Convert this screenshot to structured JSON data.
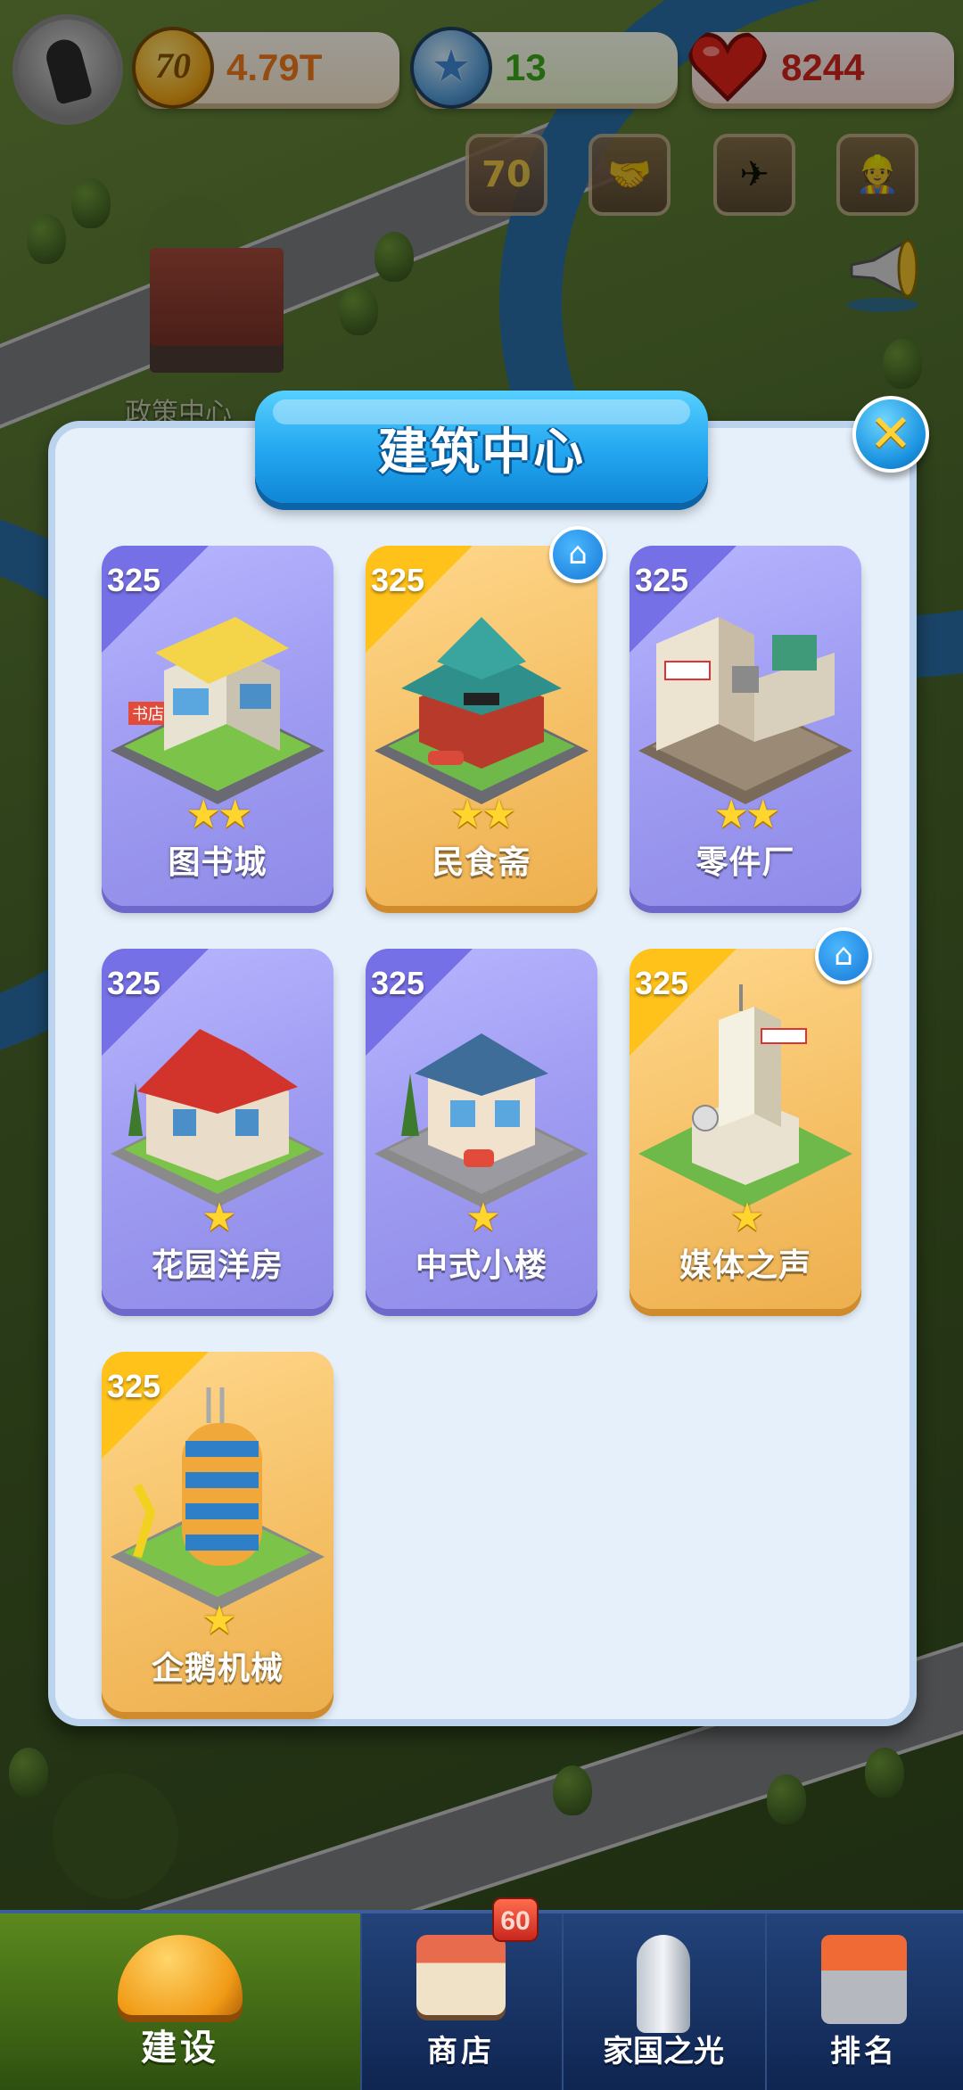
{
  "top_bar": {
    "coins": "4.79T",
    "coin_icon_text": "70",
    "stars": "13",
    "hearts": "8244",
    "colors": {
      "coins": "#f27a1a",
      "stars": "#3aa81a",
      "hearts": "#d2261e"
    }
  },
  "feature_icons": [
    {
      "icon": "anniversary-70-icon",
      "glyph": "70"
    },
    {
      "icon": "handshake-icon",
      "glyph": "🤝"
    },
    {
      "icon": "campaign-icon",
      "glyph": "✈"
    },
    {
      "icon": "worker-icon",
      "glyph": "👷"
    }
  ],
  "map": {
    "label": "政策中心"
  },
  "dialog": {
    "title": "建筑中心",
    "cards": [
      {
        "price": "325",
        "stars": "★★",
        "name": "图书城",
        "theme": "purple",
        "home_badge": false
      },
      {
        "price": "325",
        "stars": "★★",
        "name": "民食斋",
        "theme": "gold",
        "home_badge": true
      },
      {
        "price": "325",
        "stars": "★★",
        "name": "零件厂",
        "theme": "purple",
        "home_badge": false
      },
      {
        "price": "325",
        "stars": "★",
        "name": "花园洋房",
        "theme": "purple",
        "home_badge": false
      },
      {
        "price": "325",
        "stars": "★",
        "name": "中式小楼",
        "theme": "purple",
        "home_badge": false
      },
      {
        "price": "325",
        "stars": "★",
        "name": "媒体之声",
        "theme": "gold",
        "home_badge": true
      },
      {
        "price": "325",
        "stars": "★",
        "name": "企鹅机械",
        "theme": "gold",
        "home_badge": false
      }
    ]
  },
  "bottom_nav": {
    "items": [
      {
        "label": "建设",
        "icon": "hardhat-icon",
        "active": true
      },
      {
        "label": "商店",
        "icon": "shop-icon",
        "active": false
      },
      {
        "label": "家国之光",
        "icon": "rocket-icon",
        "active": false
      },
      {
        "label": "排名",
        "icon": "ranking-building-icon",
        "active": false
      }
    ],
    "shop_badge": "60"
  }
}
